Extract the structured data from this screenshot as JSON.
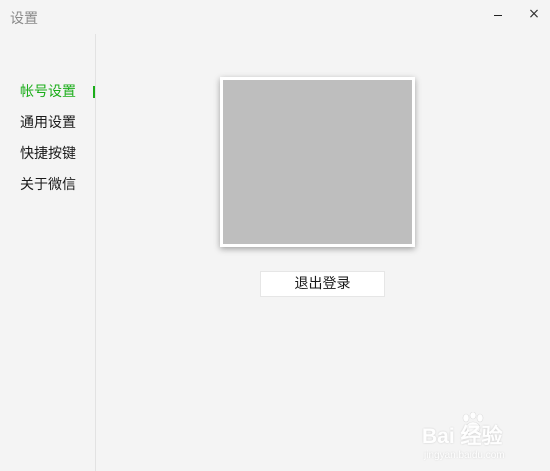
{
  "window": {
    "title": "设置",
    "minimize_icon": "minimize-icon",
    "close_icon": "close-icon",
    "close_glyph": "×"
  },
  "sidebar": {
    "items": [
      {
        "label": "帐号设置",
        "active": true
      },
      {
        "label": "通用设置",
        "active": false
      },
      {
        "label": "快捷按键",
        "active": false
      },
      {
        "label": "关于微信",
        "active": false
      }
    ]
  },
  "account": {
    "logout_label": "退出登录"
  },
  "watermark": {
    "main": "Bai 经验",
    "sub": "jingyan.baidu.com"
  },
  "colors": {
    "accent": "#1aad19",
    "background": "#f4f4f4",
    "avatar_placeholder": "#bebebe"
  }
}
